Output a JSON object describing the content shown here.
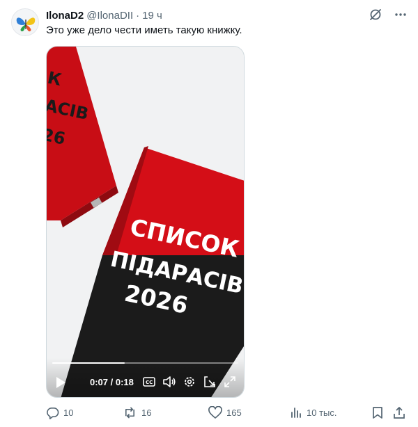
{
  "tweet": {
    "author_name": "IlonaD2",
    "author_handle": "@IlonaDII",
    "separator": "·",
    "time": "19 ч",
    "text": "Это уже дело чести иметь такую книжку."
  },
  "media": {
    "book_front": {
      "line1": "СПИСОК",
      "line2": "ПІДАРАСІВ",
      "line3": "2026"
    },
    "book_back": {
      "line1": "К",
      "line2": "АСІВ",
      "line3": "26"
    },
    "video": {
      "current_time": "0:07",
      "total_time": "0:18",
      "time_separator": " / ",
      "progress_fraction": 0.39
    }
  },
  "actions": {
    "replies": "10",
    "reposts": "16",
    "likes": "165",
    "views": "10 тыс."
  },
  "icons": {
    "top": [
      "grok-icon",
      "more-icon"
    ],
    "video": [
      "play-icon",
      "captions-icon",
      "volume-icon",
      "settings-icon",
      "pip-icon",
      "fullscreen-icon"
    ],
    "actions": [
      "reply-icon",
      "repost-icon",
      "like-icon",
      "views-icon",
      "bookmark-icon",
      "share-icon"
    ]
  },
  "colors": {
    "text_primary": "#0f1419",
    "text_secondary": "#536471",
    "book_red": "#d40e17",
    "book_black": "#1b1b1b"
  }
}
